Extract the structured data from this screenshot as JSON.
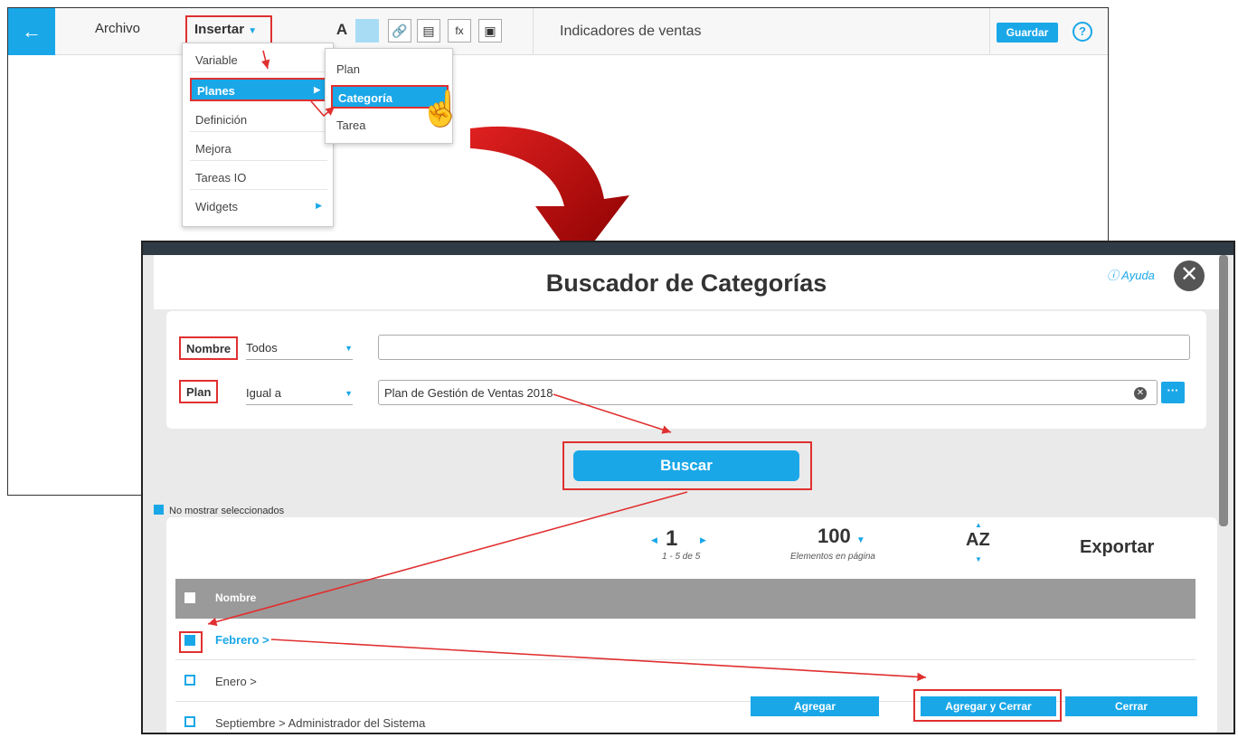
{
  "editor": {
    "menu_archivo": "Archivo",
    "menu_insertar": "Insertar",
    "doc_title": "Indicadores de ventas",
    "save_label": "Guardar",
    "help_label": "?",
    "tool_icons": [
      "text-icon",
      "color-swatch-icon",
      "link-icon",
      "chart-icon",
      "formula-icon",
      "image-icon"
    ],
    "tool_texts": {
      "text": "A",
      "formula": "fx"
    }
  },
  "insert_menu": {
    "items": [
      {
        "label": "Variable"
      },
      {
        "label": "Planes"
      },
      {
        "label": "Definición"
      },
      {
        "label": "Mejora"
      },
      {
        "label": "Tareas IO"
      },
      {
        "label": "Widgets"
      }
    ]
  },
  "planes_submenu": {
    "items": [
      {
        "label": "Plan"
      },
      {
        "label": "Categoría"
      },
      {
        "label": "Tarea"
      }
    ]
  },
  "modal": {
    "title": "Buscador de Categorías",
    "help_label": "Ayuda",
    "filters": {
      "name_label": "Nombre",
      "name_operator": "Todos",
      "name_value": "",
      "plan_label": "Plan",
      "plan_operator": "Igual a",
      "plan_value": "Plan de Gestión de Ventas 2018"
    },
    "search_label": "Buscar",
    "hide_selected_label": "No mostrar seleccionados",
    "pager": {
      "page": "1",
      "range": "1 - 5 de 5",
      "per_page": "100",
      "per_page_label": "Elementos en página",
      "sort_label": "AZ",
      "export_label": "Exportar"
    },
    "table": {
      "header": "Nombre",
      "rows": [
        {
          "name": "Febrero >",
          "checked": true
        },
        {
          "name": "Enero >",
          "checked": false
        },
        {
          "name": "Septiembre > Administrador del Sistema",
          "checked": false
        }
      ]
    },
    "actions": {
      "add": "Agregar",
      "add_close": "Agregar y Cerrar",
      "close": "Cerrar"
    }
  },
  "colors": {
    "accent": "#1aa7e8",
    "highlight": "#e03030",
    "arrow": "#c00000"
  }
}
